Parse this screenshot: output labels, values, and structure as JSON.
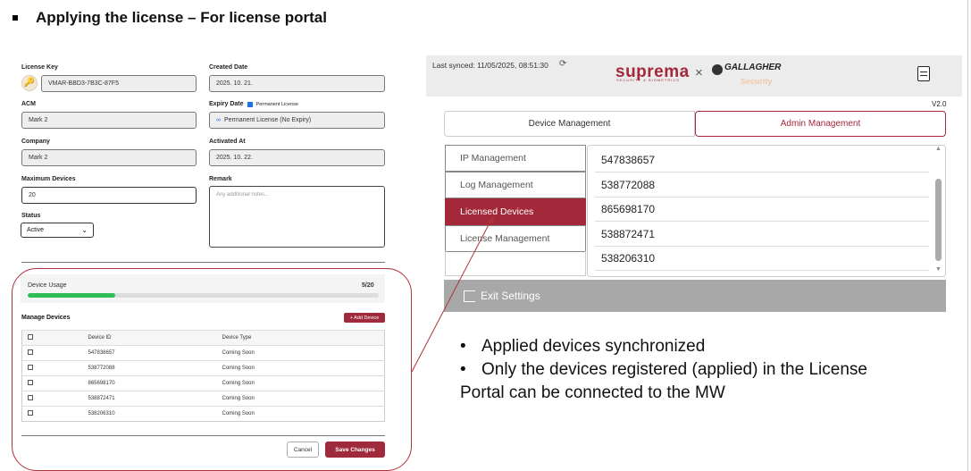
{
  "slide": {
    "title": "Applying the license – For license portal"
  },
  "license_form": {
    "license_key_label": "License Key",
    "license_key_value": "VMAR-BBD3-7B3C-87F5",
    "created_date_label": "Created Date",
    "created_date_value": "2025. 10. 21.",
    "acm_label": "ACM",
    "acm_value": "Mark 2",
    "expiry_date_label": "Expiry Date",
    "permanent_license_checkbox_label": "Permanent License",
    "expiry_date_value": "Permanent License (No Expiry)",
    "company_label": "Company",
    "company_value": "Mark 2",
    "activated_at_label": "Activated At",
    "activated_at_value": "2025. 10. 22.",
    "max_devices_label": "Maximum Devices",
    "max_devices_value": "20",
    "remark_label": "Remark",
    "remark_placeholder": "Any additional notes...",
    "status_label": "Status",
    "status_value": "Active",
    "device_usage_label": "Device Usage",
    "device_usage_count": "5/20",
    "device_usage_fraction": 0.25,
    "manage_devices_title": "Manage Devices",
    "add_device_label": "+ Add Device",
    "table_headers": [
      "",
      "Device ID",
      "Device Type"
    ],
    "devices": [
      {
        "id": "547838657",
        "type": "Coming Soon"
      },
      {
        "id": "538772088",
        "type": "Coming Soon"
      },
      {
        "id": "865698170",
        "type": "Coming Soon"
      },
      {
        "id": "538872471",
        "type": "Coming Soon"
      },
      {
        "id": "538206310",
        "type": "Coming Soon"
      }
    ],
    "cancel_label": "Cancel",
    "save_label": "Save Changes"
  },
  "mw": {
    "last_synced": "Last synced: 11/05/2025, 08:51:30",
    "brand_suprema": "suprema",
    "brand_suprema_sub": "SECURITY & BIOMETRICS",
    "brand_x": "×",
    "brand_gallagher": "GALLAGHER",
    "brand_security": "Security",
    "version": "V2.0",
    "tabs": {
      "device": "Device Management",
      "admin": "Admin Management"
    },
    "sidebar": [
      {
        "label": "IP Management"
      },
      {
        "label": "Log Management"
      },
      {
        "label": "Licensed Devices"
      },
      {
        "label": "License Management"
      }
    ],
    "licensed_devices": [
      "547838657",
      "538772088",
      "865698170",
      "538872471",
      "538206310"
    ],
    "exit_label": "Exit Settings",
    "accent_color": "#a3283a"
  },
  "notes": {
    "line1": "Applied devices synchronized",
    "line2": "Only the devices registered (applied) in the License Portal can be connected to the MW"
  }
}
